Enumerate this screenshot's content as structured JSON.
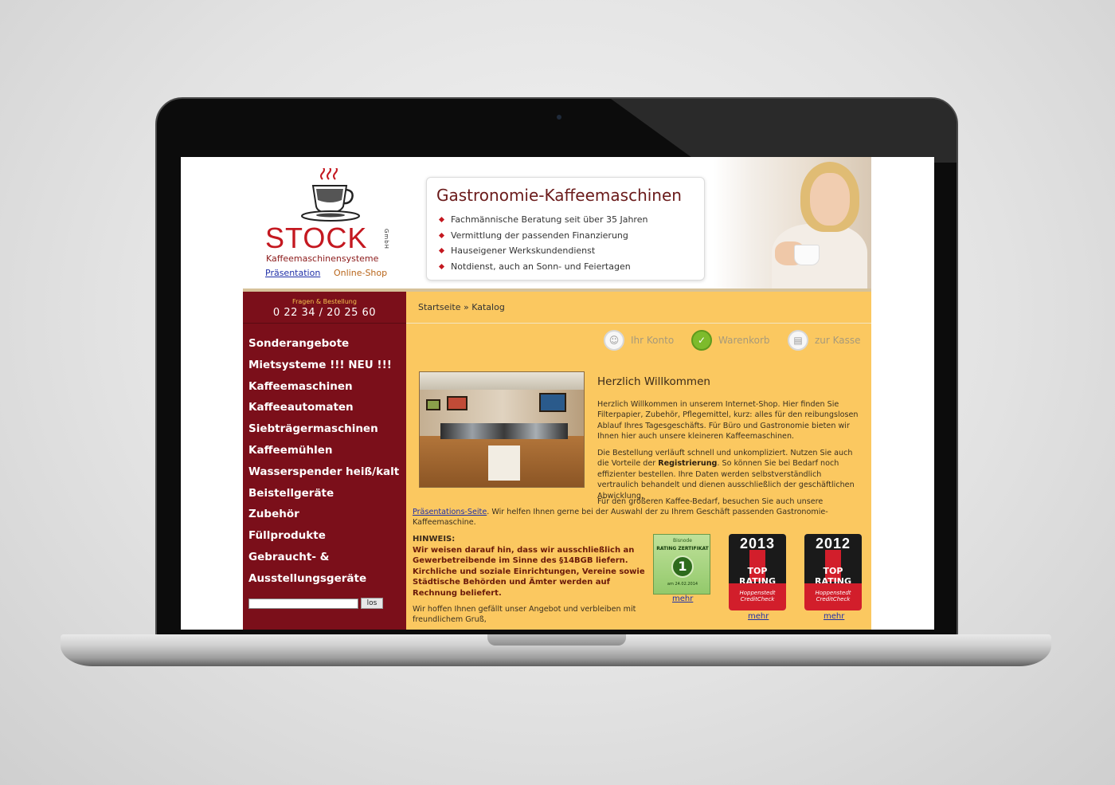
{
  "header": {
    "logo_text": "STOCK",
    "logo_gmbh": "GmbH",
    "logo_subtitle": "Kaffeemaschinensysteme",
    "link_presentation": "Präsentation",
    "link_shop": "Online-Shop",
    "promo_title": "Gastronomie-Kaffeemaschinen",
    "promo_items": [
      "Fachmännische Beratung seit über 35 Jahren",
      "Vermittlung der passenden Finanzierung",
      "Hauseigener Werkskundendienst",
      "Notdienst, auch an Sonn- und Feiertagen"
    ]
  },
  "sidebar": {
    "phone_label": "Fragen & Bestellung",
    "phone_number": "0 22 34 / 20 25 60",
    "nav": [
      "Sonderangebote",
      "Mietsysteme !!! NEU !!!",
      "Kaffeemaschinen",
      "Kaffeeautomaten",
      "Siebträgermaschinen",
      "Kaffeemühlen",
      "Wasserspender heiß/kalt",
      "Beistellgeräte",
      "Zubehör",
      "Füllprodukte",
      "Gebraucht- &",
      "Ausstellungsgeräte"
    ],
    "search_button": "los"
  },
  "main": {
    "breadcrumb": "Startseite » Katalog",
    "account": {
      "konto": "Ihr Konto",
      "warenkorb": "Warenkorb",
      "kasse": "zur Kasse"
    },
    "welcome_title": "Herzlich Willkommen",
    "para1": "Herzlich Willkommen in unserem Internet-Shop. Hier finden Sie Filterpapier, Zubehör, Pflegemittel, kurz: alles für den reibungslosen Ablauf Ihres Tagesgeschäfts. Für Büro und Gastronomie bieten wir Ihnen hier auch unsere kleineren Kaffeemaschinen.",
    "para2_a": "Die Bestellung verläuft schnell und unkompliziert. Nutzen Sie auch die Vorteile der ",
    "para2_bold": "Registrierung",
    "para2_b": ". So können Sie bei Bedarf noch effizienter bestellen. Ihre Daten werden selbstverständlich vertraulich behandelt und dienen ausschließlich der geschäftlichen Abwicklung.",
    "para3_a": "Für den größeren Kaffee-Bedarf, besuchen Sie auch unsere",
    "para3_link": "Präsentations-Seite",
    "para3_b": ". Wir helfen Ihnen gerne bei der Auswahl der zu Ihrem Geschäft passenden Gastronomie-Kaffeemaschine.",
    "hinweis_label": "HINWEIS:",
    "hinweis_text": "Wir weisen darauf hin, dass wir ausschließlich an Gewerbetreibende im Sinne des §14BGB liefern. Kirchliche und soziale Einrichtungen, Vereine sowie Städtische Behörden und Ämter werden auf Rechnung beliefert.",
    "closing": "Wir hoffen Ihnen gefällt unser Angebot und verbleiben mit freundlichem Gruß,"
  },
  "badges": {
    "cert": {
      "head": "Bisnode",
      "title": "RATING ZERTIFIKAT",
      "seal": "1",
      "date": "am 24.02.2014",
      "mehr": "mehr"
    },
    "ratings": [
      {
        "year": "2013",
        "text": "TOP RATING",
        "brand": "Hoppenstedt CreditCheck",
        "mehr": "mehr"
      },
      {
        "year": "2012",
        "text": "TOP RATING",
        "brand": "Hoppenstedt CreditCheck",
        "mehr": "mehr"
      }
    ]
  },
  "colors": {
    "sidebar": "#7b0f1a",
    "main": "#fbc860",
    "brand_red": "#c41820",
    "link": "#2030a8"
  }
}
